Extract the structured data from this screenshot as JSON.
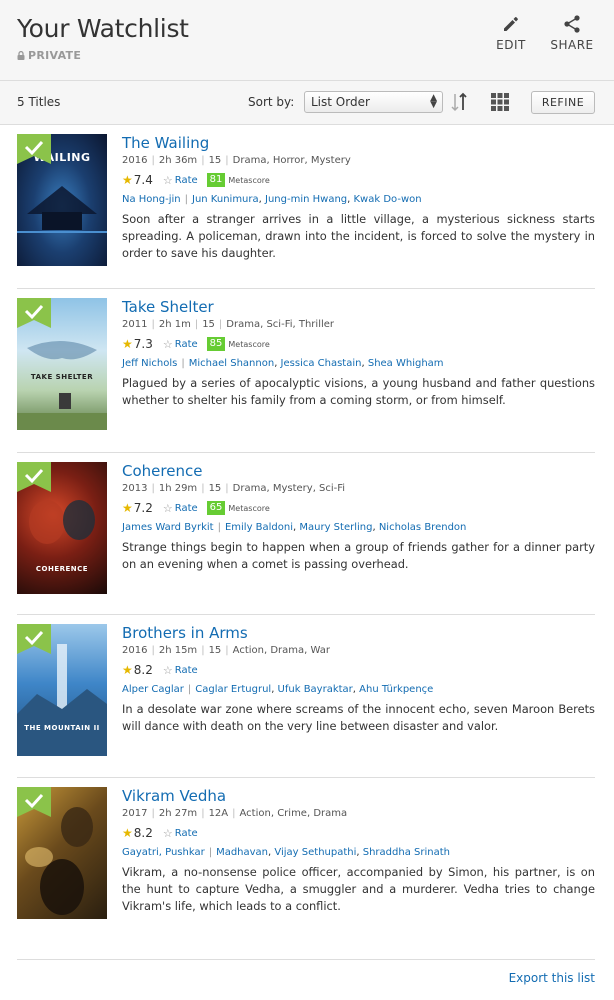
{
  "header": {
    "title": "Your Watchlist",
    "privacy": "PRIVATE",
    "edit_label": "EDIT",
    "share_label": "SHARE"
  },
  "toolbar": {
    "count": "5 Titles",
    "sort_label": "Sort by:",
    "sort_value": "List Order",
    "refine_label": "REFINE"
  },
  "items": [
    {
      "title": "The Wailing",
      "poster_text": "WAILING",
      "year": "2016",
      "runtime": "2h 36m",
      "cert": "15",
      "genres": "Drama, Horror, Mystery",
      "rating": "7.4",
      "rate_label": "Rate",
      "metascore": "81",
      "metascore_label": "Metascore",
      "director": "Na Hong-jin",
      "cast": [
        "Jun Kunimura",
        "Jung-min Hwang",
        "Kwak Do-won"
      ],
      "plot": "Soon after a stranger arrives in a little village, a mysterious sickness starts spreading. A policeman, drawn into the incident, is forced to solve the mystery in order to save his daughter."
    },
    {
      "title": "Take Shelter",
      "poster_text": "TAKE SHELTER",
      "year": "2011",
      "runtime": "2h 1m",
      "cert": "15",
      "genres": "Drama, Sci-Fi, Thriller",
      "rating": "7.3",
      "rate_label": "Rate",
      "metascore": "85",
      "metascore_label": "Metascore",
      "director": "Jeff Nichols",
      "cast": [
        "Michael Shannon",
        "Jessica Chastain",
        "Shea Whigham"
      ],
      "plot": "Plagued by a series of apocalyptic visions, a young husband and father questions whether to shelter his family from a coming storm, or from himself."
    },
    {
      "title": "Coherence",
      "poster_text": "COHERENCE",
      "year": "2013",
      "runtime": "1h 29m",
      "cert": "15",
      "genres": "Drama, Mystery, Sci-Fi",
      "rating": "7.2",
      "rate_label": "Rate",
      "metascore": "65",
      "metascore_label": "Metascore",
      "director": "James Ward Byrkit",
      "cast": [
        "Emily Baldoni",
        "Maury Sterling",
        "Nicholas Brendon"
      ],
      "plot": "Strange things begin to happen when a group of friends gather for a dinner party on an evening when a comet is passing overhead."
    },
    {
      "title": "Brothers in Arms",
      "poster_text": "THE MOUNTAIN II",
      "year": "2016",
      "runtime": "2h 15m",
      "cert": "15",
      "genres": "Action, Drama, War",
      "rating": "8.2",
      "rate_label": "Rate",
      "metascore": "",
      "metascore_label": "",
      "director": "Alper Caglar",
      "cast": [
        "Caglar Ertugrul",
        "Ufuk Bayraktar",
        "Ahu Türkpençe"
      ],
      "plot": "In a desolate war zone where screams of the innocent echo, seven Maroon Berets will dance with death on the very line between disaster and valor."
    },
    {
      "title": "Vikram Vedha",
      "poster_text": "",
      "year": "2017",
      "runtime": "2h 27m",
      "cert": "12A",
      "genres": "Action, Crime, Drama",
      "rating": "8.2",
      "rate_label": "Rate",
      "metascore": "",
      "metascore_label": "",
      "director": "Gayatri, Pushkar",
      "cast": [
        "Madhavan",
        "Vijay Sethupathi",
        "Shraddha Srinath"
      ],
      "plot": "Vikram, a no-nonsense police officer, accompanied by Simon, his partner, is on the hunt to capture Vedha, a smuggler and a murderer. Vedha tries to change Vikram's life, which leads to a conflict."
    }
  ],
  "footer": {
    "export_label": "Export this list"
  },
  "colors": {
    "link": "#136cb2",
    "metascore_bg": "#66cc33",
    "star": "#e6b800",
    "ribbon": "#8bc34a"
  }
}
